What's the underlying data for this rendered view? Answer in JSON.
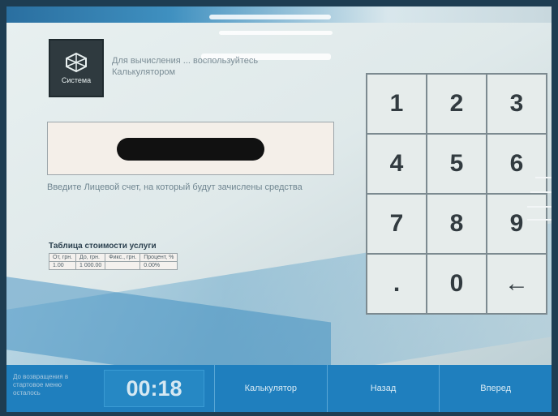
{
  "header": {
    "logo_text": "Система",
    "hint": "Для вычисления ... воспользуйтесь Калькулятором"
  },
  "account": {
    "value_redacted": true,
    "hint": "Введите Лицевой счет, на который будут зачислены средства"
  },
  "fee_table": {
    "title": "Таблица стоимости услуги",
    "columns": [
      "От, грн.",
      "До, грн.",
      "Фикс., грн.",
      "Процент, %"
    ],
    "rows": [
      [
        "1.00",
        "1 000.00",
        "",
        "0.00%"
      ]
    ]
  },
  "keypad": {
    "keys": [
      "1",
      "2",
      "3",
      "4",
      "5",
      "6",
      "7",
      "8",
      "9",
      ".",
      "0",
      "←"
    ]
  },
  "bottom_bar": {
    "note": "До возвращения в стартовое меню осталось",
    "timer": "00:18",
    "calculator_label": "Калькулятор",
    "back_label": "Назад",
    "next_label": "Вперед"
  },
  "colors": {
    "bottom_bar": "#1f7fbe",
    "keypad_key": "#e6eceb",
    "logo_bg": "#2f3a3f"
  }
}
